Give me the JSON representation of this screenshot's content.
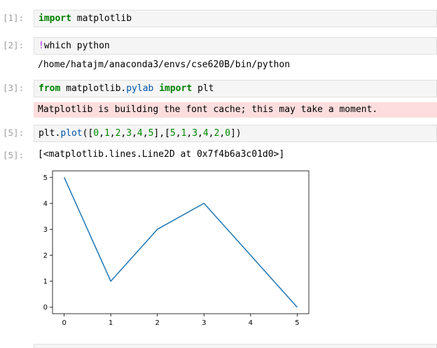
{
  "cells": [
    {
      "prompt": "[1]:",
      "tokens": [
        {
          "t": "import",
          "c": "kw"
        },
        {
          "t": " matplotlib",
          "c": "punc"
        }
      ]
    },
    {
      "prompt": "[2]:",
      "tokens": [
        {
          "t": "!",
          "c": "bang"
        },
        {
          "t": "which python",
          "c": "punc"
        }
      ],
      "output": "/home/hatajm/anaconda3/envs/cse620B/bin/python"
    },
    {
      "prompt": "[3]:",
      "tokens": [
        {
          "t": "from",
          "c": "kw"
        },
        {
          "t": " matplotlib.",
          "c": "punc"
        },
        {
          "t": "pylab",
          "c": "fn"
        },
        {
          "t": " ",
          "c": "punc"
        },
        {
          "t": "import",
          "c": "kw"
        },
        {
          "t": " plt",
          "c": "punc"
        }
      ],
      "stderr": "Matplotlib is building the font cache; this may take a moment."
    },
    {
      "prompt": "[5]:",
      "tokens": [
        {
          "t": "plt.",
          "c": "punc"
        },
        {
          "t": "plot",
          "c": "fn"
        },
        {
          "t": "([",
          "c": "punc"
        },
        {
          "t": "0",
          "c": "num"
        },
        {
          "t": ",",
          "c": "punc"
        },
        {
          "t": "1",
          "c": "num"
        },
        {
          "t": ",",
          "c": "punc"
        },
        {
          "t": "2",
          "c": "num"
        },
        {
          "t": ",",
          "c": "punc"
        },
        {
          "t": "3",
          "c": "num"
        },
        {
          "t": ",",
          "c": "punc"
        },
        {
          "t": "4",
          "c": "num"
        },
        {
          "t": ",",
          "c": "punc"
        },
        {
          "t": "5",
          "c": "num"
        },
        {
          "t": "],[",
          "c": "punc"
        },
        {
          "t": "5",
          "c": "num"
        },
        {
          "t": ",",
          "c": "punc"
        },
        {
          "t": "1",
          "c": "num"
        },
        {
          "t": ",",
          "c": "punc"
        },
        {
          "t": "3",
          "c": "num"
        },
        {
          "t": ",",
          "c": "punc"
        },
        {
          "t": "4",
          "c": "num"
        },
        {
          "t": ",",
          "c": "punc"
        },
        {
          "t": "2",
          "c": "num"
        },
        {
          "t": ",",
          "c": "punc"
        },
        {
          "t": "0",
          "c": "num"
        },
        {
          "t": "])",
          "c": "punc"
        }
      ],
      "out_prompt": "[5]:",
      "output": "[<matplotlib.lines.Line2D at 0x7f4b6a3c01d0>]"
    }
  ],
  "colors": {
    "line": "#1f77b4",
    "keyword": "#008000",
    "function": "#0055aa",
    "number": "#008800",
    "stderr_bg": "#fddddd",
    "cell_bg": "#f5f5f5"
  },
  "chart_data": {
    "type": "line",
    "x": [
      0,
      1,
      2,
      3,
      4,
      5
    ],
    "series": [
      {
        "values": [
          5,
          1,
          3,
          4,
          2,
          0
        ]
      }
    ],
    "xticks": [
      "0",
      "1",
      "2",
      "3",
      "4",
      "5"
    ],
    "yticks": [
      "0",
      "1",
      "2",
      "3",
      "4",
      "5"
    ],
    "xlim": [
      -0.25,
      5.25
    ],
    "ylim": [
      -0.25,
      5.25
    ],
    "grid": false
  }
}
